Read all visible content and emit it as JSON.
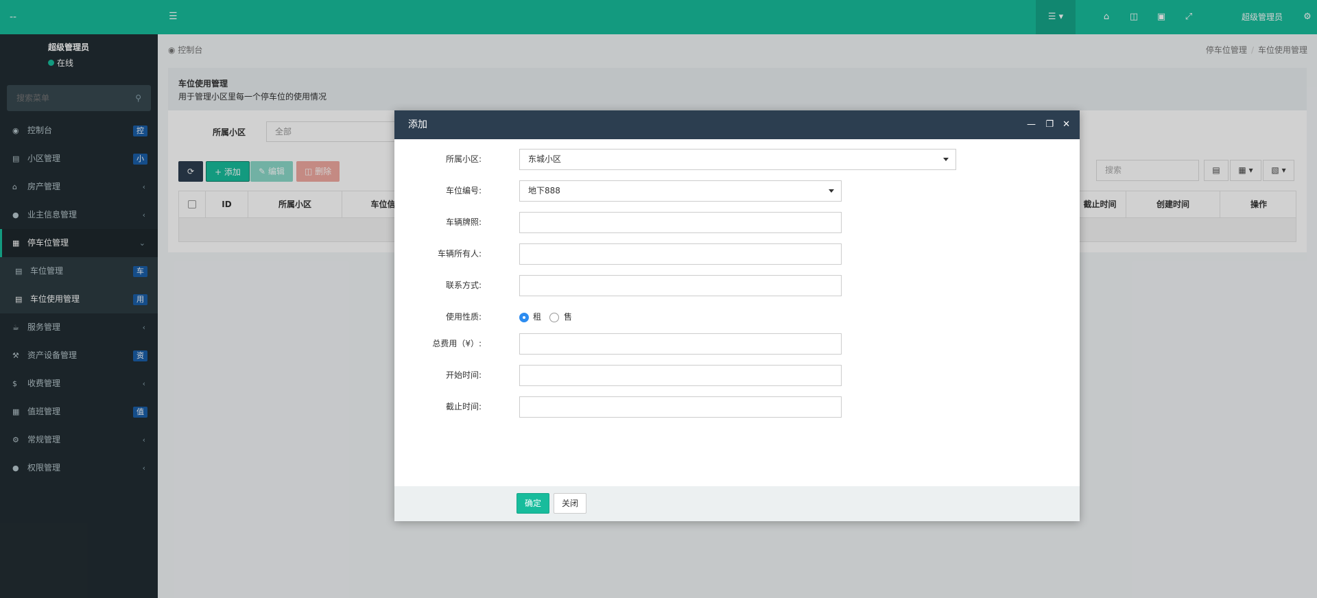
{
  "app": {
    "logo_text": "--"
  },
  "sidebar": {
    "user_name": "超级管理员",
    "user_status": "在线",
    "search_placeholder": "搜索菜单",
    "items": [
      {
        "label": "控制台",
        "badge": "控"
      },
      {
        "label": "小区管理",
        "badge": "小"
      },
      {
        "label": "房产管理"
      },
      {
        "label": "业主信息管理"
      },
      {
        "label": "停车位管理"
      },
      {
        "label": "车位管理",
        "badge": "车"
      },
      {
        "label": "车位使用管理",
        "badge": "用"
      },
      {
        "label": "服务管理"
      },
      {
        "label": "资产设备管理",
        "badge": "资"
      },
      {
        "label": "收费管理"
      },
      {
        "label": "值班管理",
        "badge": "值"
      },
      {
        "label": "常规管理"
      },
      {
        "label": "权限管理"
      }
    ]
  },
  "header": {
    "user_label": "超级管理员"
  },
  "breadcrumb": {
    "home": "控制台",
    "level1": "停车位管理",
    "level2": "车位使用管理"
  },
  "panel": {
    "title": "车位使用管理",
    "description": "用于管理小区里每一个停车位的使用情况"
  },
  "filter": {
    "label": "所属小区",
    "value": "全部"
  },
  "toolbar": {
    "add": "添加",
    "edit": "编辑",
    "delete": "删除",
    "search_placeholder": "搜索"
  },
  "table": {
    "columns": [
      "ID",
      "所属小区",
      "车位信",
      "截止时间",
      "创建时间",
      "操作"
    ]
  },
  "modal": {
    "title": "添加",
    "fields": {
      "community_label": "所属小区:",
      "community_value": "东城小区",
      "space_label": "车位编号:",
      "space_value": "地下888",
      "plate_label": "车辆牌照:",
      "owner_label": "车辆所有人:",
      "contact_label": "联系方式:",
      "usage_label": "使用性质:",
      "usage_option_rent": "租",
      "usage_option_sell": "售",
      "fee_label": "总费用（¥）:",
      "start_label": "开始时间:",
      "end_label": "截止时间:"
    },
    "confirm": "确定",
    "close": "关闭"
  },
  "colors": {
    "brand": "#18bc9c",
    "sidebar_bg": "#222d32",
    "modal_header": "#2c3e50",
    "badge": "#1a5ea8"
  }
}
